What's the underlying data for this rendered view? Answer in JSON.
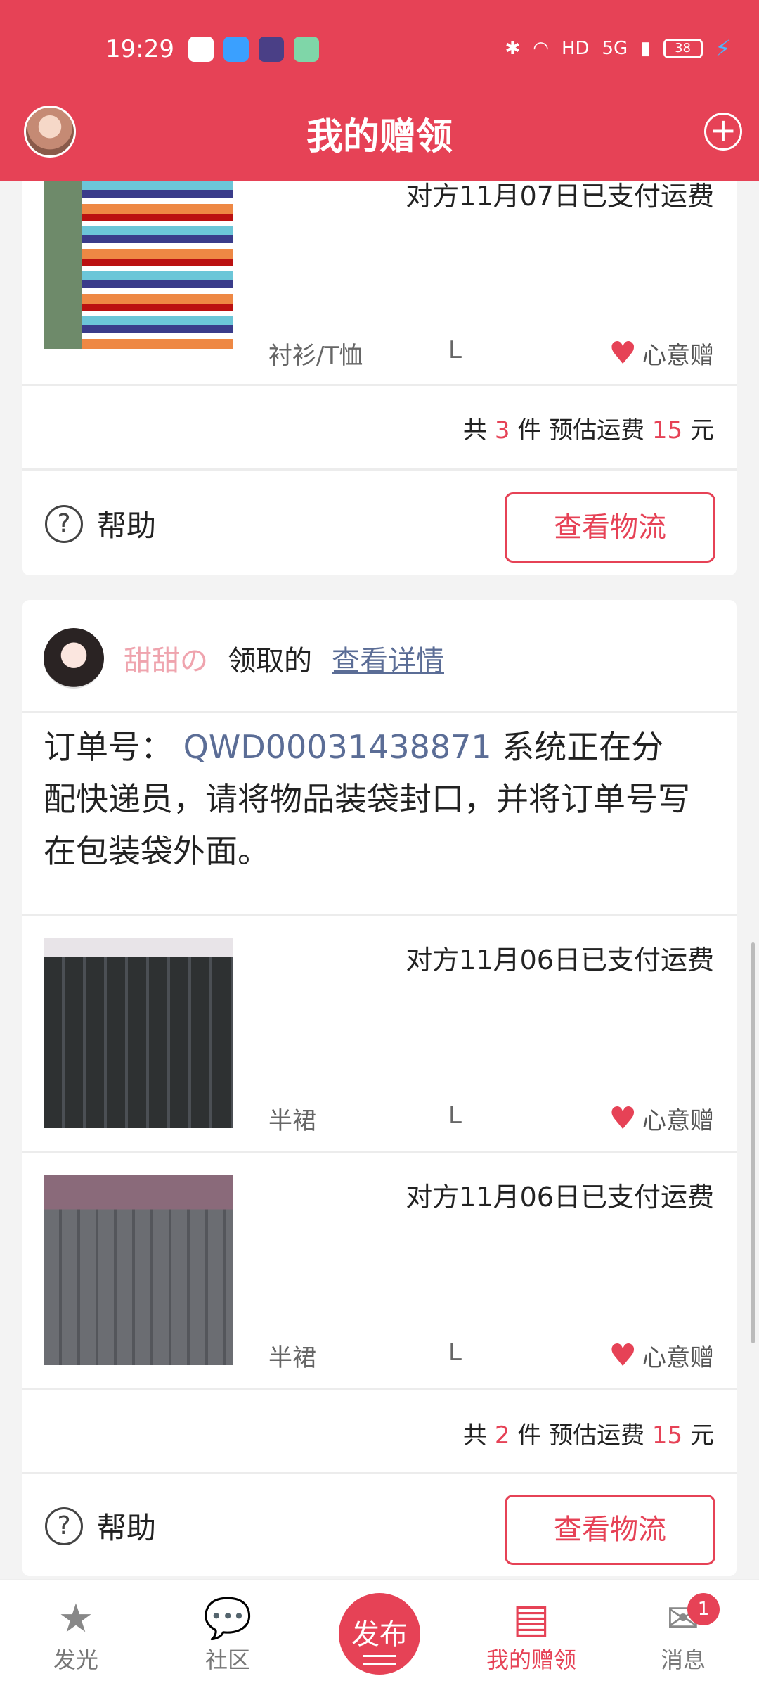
{
  "status_bar": {
    "time": "19:29",
    "bluetooth_icon": "bluetooth-icon",
    "hd_badge": "HD",
    "network": "5G",
    "battery": "38"
  },
  "header": {
    "title": "我的赠领",
    "avatar_icon": "avatar",
    "add_icon": "plus-circle-icon",
    "add_glyph": "+"
  },
  "orders": [
    {
      "items": [
        {
          "paid_text": "对方11月07日已支付运费",
          "category": "衬衫/T恤",
          "size": "L",
          "gift_label": "心意赠"
        }
      ],
      "summary": {
        "prefix": "共",
        "count": "3",
        "mid": "件 预估运费",
        "fee": "15",
        "suffix": "元"
      },
      "help_label": "帮助",
      "help_glyph": "?",
      "track_label": "查看物流"
    },
    {
      "claimer": {
        "name": "甜甜の",
        "action": "领取的",
        "detail_link": "查看详情"
      },
      "order_label": "订单号：",
      "order_no": "QWD00031438871",
      "order_msg": "系统正在分配快递员，请将物品装袋封口，并将订单号写在包装袋外面。",
      "items": [
        {
          "paid_text": "对方11月06日已支付运费",
          "category": "半裙",
          "size": "L",
          "gift_label": "心意赠"
        },
        {
          "paid_text": "对方11月06日已支付运费",
          "category": "半裙",
          "size": "L",
          "gift_label": "心意赠"
        }
      ],
      "summary": {
        "prefix": "共",
        "count": "2",
        "mid": "件 预估运费",
        "fee": "15",
        "suffix": "元"
      },
      "help_label": "帮助",
      "help_glyph": "?",
      "track_label": "查看物流"
    }
  ],
  "bottom_nav": {
    "items": [
      {
        "label": "发光",
        "icon": "star-icon",
        "glyph": "★"
      },
      {
        "label": "社区",
        "icon": "chat-bubble-icon",
        "glyph": "💬"
      },
      {
        "label": "发布",
        "icon": "publish-icon"
      },
      {
        "label": "我的赠领",
        "icon": "gift-box-icon",
        "glyph": "▤",
        "active": true
      },
      {
        "label": "消息",
        "icon": "mail-icon",
        "glyph": "✉",
        "badge": "1"
      }
    ]
  },
  "colors": {
    "brand": "#e64256",
    "link": "#5b6d96",
    "claimer_name": "#efa4ae"
  }
}
